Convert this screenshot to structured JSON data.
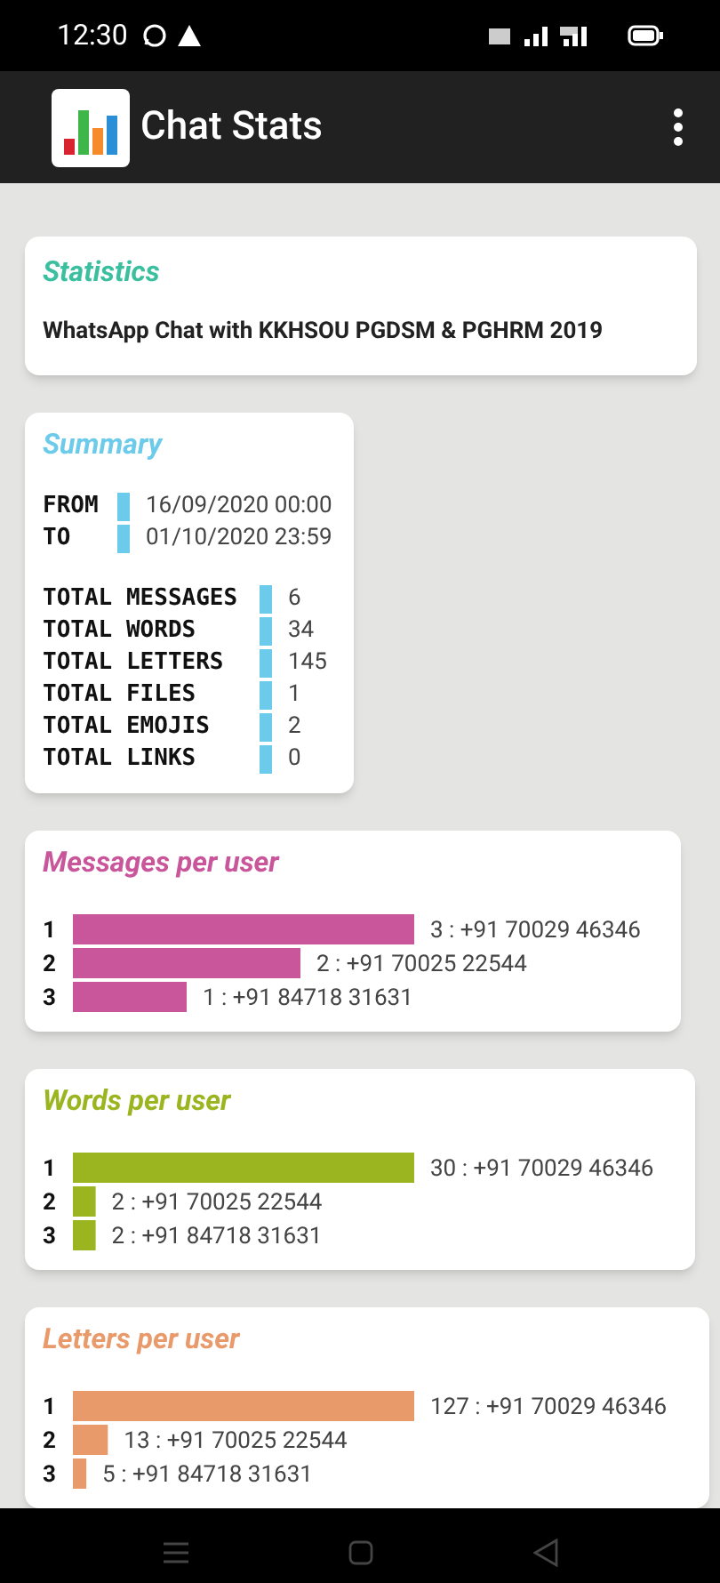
{
  "status_bar": {
    "time": "12:30"
  },
  "app_bar": {
    "title": "Chat Stats"
  },
  "statistics": {
    "title": "Statistics",
    "chat_name": "WhatsApp Chat with KKHSOU PGDSM & PGHRM 2019"
  },
  "summary": {
    "title": "Summary",
    "range": [
      {
        "label": "FROM",
        "value": "16/09/2020 00:00"
      },
      {
        "label": "TO",
        "value": "01/10/2020 23:59"
      }
    ],
    "totals": [
      {
        "label": "TOTAL MESSAGES",
        "value": "6"
      },
      {
        "label": "TOTAL WORDS",
        "value": "34"
      },
      {
        "label": "TOTAL LETTERS",
        "value": "145"
      },
      {
        "label": "TOTAL FILES",
        "value": "1"
      },
      {
        "label": "TOTAL EMOJIS",
        "value": "2"
      },
      {
        "label": "TOTAL LINKS",
        "value": "0"
      }
    ]
  },
  "charts": [
    {
      "title": "Messages per user",
      "color": "#c9559a",
      "chart_data": {
        "type": "bar",
        "orientation": "horizontal",
        "categories": [
          "1",
          "2",
          "3"
        ],
        "values": [
          3,
          2,
          1
        ],
        "value_labels": [
          "3 : +91 70029 46346",
          "2 : +91 70025 22544",
          "1 : +91 84718 31631"
        ]
      }
    },
    {
      "title": "Words per user",
      "color": "#9ab51f",
      "chart_data": {
        "type": "bar",
        "orientation": "horizontal",
        "categories": [
          "1",
          "2",
          "3"
        ],
        "values": [
          30,
          2,
          2
        ],
        "value_labels": [
          "30 : +91 70029 46346",
          "2 : +91 70025 22544",
          "2 : +91 84718 31631"
        ]
      }
    },
    {
      "title": "Letters per user",
      "color": "#e99a6b",
      "chart_data": {
        "type": "bar",
        "orientation": "horizontal",
        "categories": [
          "1",
          "2",
          "3"
        ],
        "values": [
          127,
          13,
          5
        ],
        "value_labels": [
          "127 : +91 70029 46346",
          "13 : +91 70025 22544",
          "5 : +91 84718 31631"
        ]
      }
    }
  ]
}
